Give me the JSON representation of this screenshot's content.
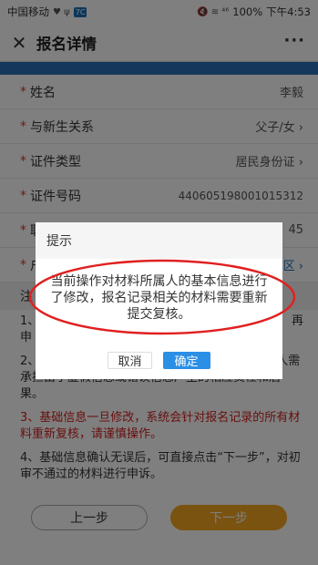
{
  "status_bar": {
    "carrier": "中国移动",
    "extra_icons": "♥ ψ",
    "badge": "7C",
    "signal_icons": "🔇 ≋ ⁴⁶",
    "battery": "100%",
    "time": "下午4:53"
  },
  "header": {
    "title": "报名详情",
    "close_glyph": "✕",
    "more_glyph": "···"
  },
  "form": {
    "rows": [
      {
        "label": "姓名",
        "value": "李毅"
      },
      {
        "label": "与新生关系",
        "value": "父子/女 ›"
      },
      {
        "label": "证件类型",
        "value": "居民身份证 ›"
      },
      {
        "label": "证件号码",
        "value": "440605198001015312"
      },
      {
        "label": "联",
        "value": "45"
      },
      {
        "label": "户",
        "value": "区 ›"
      }
    ]
  },
  "notice": {
    "title": "注",
    "items": [
      "1、",
      "2、请重新核对基础信息的真实性和准确性，监护人需承担由于虚假信息或错误信息产生的相应责任和后果。",
      "3、基础信息一旦修改，系统会针对报名记录的所有材料重新复核，请谨慎操作。",
      "4、基础信息确认无误后，可直接点击“下一步”，对初审不通过的材料进行申诉。"
    ],
    "item1_right": "再",
    "item1_line2": "申"
  },
  "buttons": {
    "prev": "上一步",
    "next": "下一步"
  },
  "dialog": {
    "title": "提示",
    "message": "当前操作对材料所属人的基本信息进行了修改，报名记录相关的材料需要重新提交复核。",
    "cancel": "取消",
    "ok": "确定"
  },
  "colors": {
    "accent_blue": "#2c6fb8",
    "ok_button": "#2b8fe6",
    "next_button": "#f5a623",
    "warning_red": "#d21f1f",
    "annotation_red": "#e02020"
  }
}
